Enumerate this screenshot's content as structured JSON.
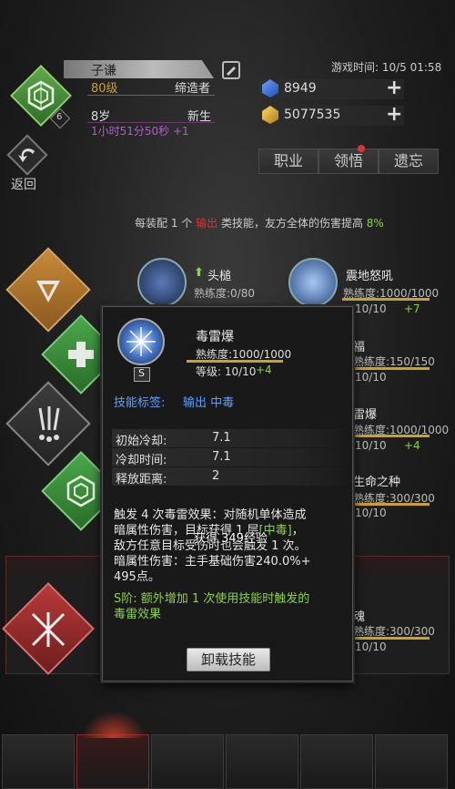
{
  "player": {
    "name": "子谦",
    "level": "80级",
    "title": "缔造者",
    "age": "8岁",
    "stage": "新生",
    "timer": "1小时51分50秒 +1",
    "avatar_level": "6"
  },
  "game_time": "游戏时间: 10/5 01:58",
  "resources": {
    "gems": "8949",
    "gold": "5077535"
  },
  "back_label": "返回",
  "tabs": [
    {
      "label": "职业"
    },
    {
      "label": "领悟"
    },
    {
      "label": "遗忘"
    }
  ],
  "bonus_text": {
    "prefix": "每装配 1 个",
    "highlight": "输出",
    "middle": "类技能，友方全体的伤害提高",
    "percent": "8%"
  },
  "skills": {
    "s1": {
      "name": "头槌",
      "prof": "熟练度:0/80"
    },
    "s2": {
      "name": "震地怒吼",
      "prof": "熟练度:1000/1000",
      "level": "10/10",
      "bonus": "+7"
    },
    "s3": {
      "name": "福",
      "prof": "熟练度:150/150",
      "level": "10/10"
    },
    "s4": {
      "name": "雷爆",
      "prof": "熟练度:1000/1000",
      "level": "10/10",
      "bonus": "+4"
    },
    "s5": {
      "name": "生命之种",
      "prof": "熟练度:300/300",
      "level": "10/10"
    },
    "s6": {
      "name": "魂",
      "prof": "熟练度:300/300",
      "level": "10/10"
    }
  },
  "popup": {
    "name": "毒雷爆",
    "prof": "熟练度:1000/1000",
    "level": "等级: 10/10",
    "level_bonus": "+4",
    "rank": "S",
    "tags_label": "技能标签:",
    "tags": "输出 中毒",
    "stats": [
      {
        "label": "初始冷却:",
        "value": "7.1"
      },
      {
        "label": "冷却时间:",
        "value": "7.1"
      },
      {
        "label": "释放距离:",
        "value": "2"
      }
    ],
    "desc": [
      "触发 4 次毒雷效果：对随机单体造成",
      "暗属性伤害，目标获得 1 层",
      "敌方任意目标受伤时也会触发 1 次。",
      "暗属性伤害：主手基础伤害240.0%+",
      "495点。"
    ],
    "desc_tag": "[中毒]",
    "desc_tail": "，",
    "overlay_exp": "获得 349经验",
    "s_bonus": [
      "S阶: 额外增加 1 次使用技能时触发的",
      "毒雷效果"
    ],
    "unload": "卸载技能"
  },
  "colors": {
    "green": "#8ad24a",
    "red": "#d33",
    "blue": "#5aa0ff",
    "gold": "#c9a227"
  }
}
